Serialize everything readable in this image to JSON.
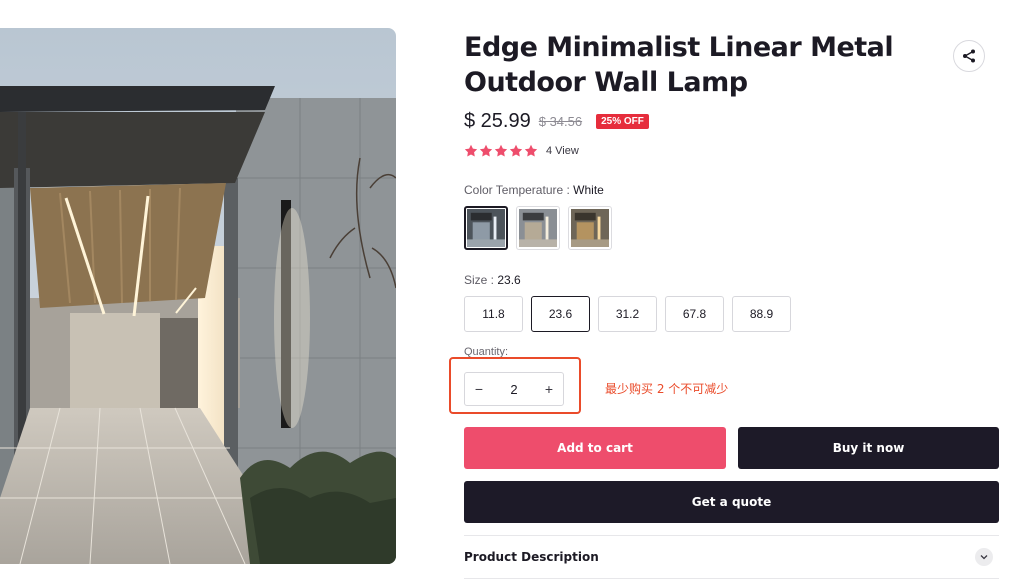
{
  "product": {
    "title": "Edge Minimalist Linear Metal Outdoor Wall Lamp",
    "price": "$ 25.99",
    "compare_price": "$ 34.56",
    "discount_badge": "25% OFF",
    "rating": 5,
    "review_count": "4 View",
    "image_icon": "product-photo",
    "share_icon": "share-icon"
  },
  "color": {
    "label": "Color Temperature : ",
    "selected": "White",
    "swatch_count": 3,
    "selected_index": 0
  },
  "size": {
    "label": "Size : ",
    "selected": "23.6",
    "options": [
      "11.8",
      "23.6",
      "31.2",
      "67.8",
      "88.9"
    ]
  },
  "quantity": {
    "label": "Quantity:",
    "value": "2",
    "minus": "−",
    "plus": "+"
  },
  "annotation": {
    "text": "最少购买 2 个不可减少",
    "color": "#ea4b2a"
  },
  "buttons": {
    "add_to_cart": "Add to cart",
    "buy_now": "Buy it now",
    "get_quote": "Get a quote"
  },
  "accordion": {
    "description_title": "Product Description",
    "chevron_icon": "chevron-down-icon"
  },
  "colors": {
    "accent_pink": "#ee4d6c",
    "dark": "#1d1a28",
    "badge_red": "#e62d3c",
    "star_pink": "#ee4d6c"
  }
}
